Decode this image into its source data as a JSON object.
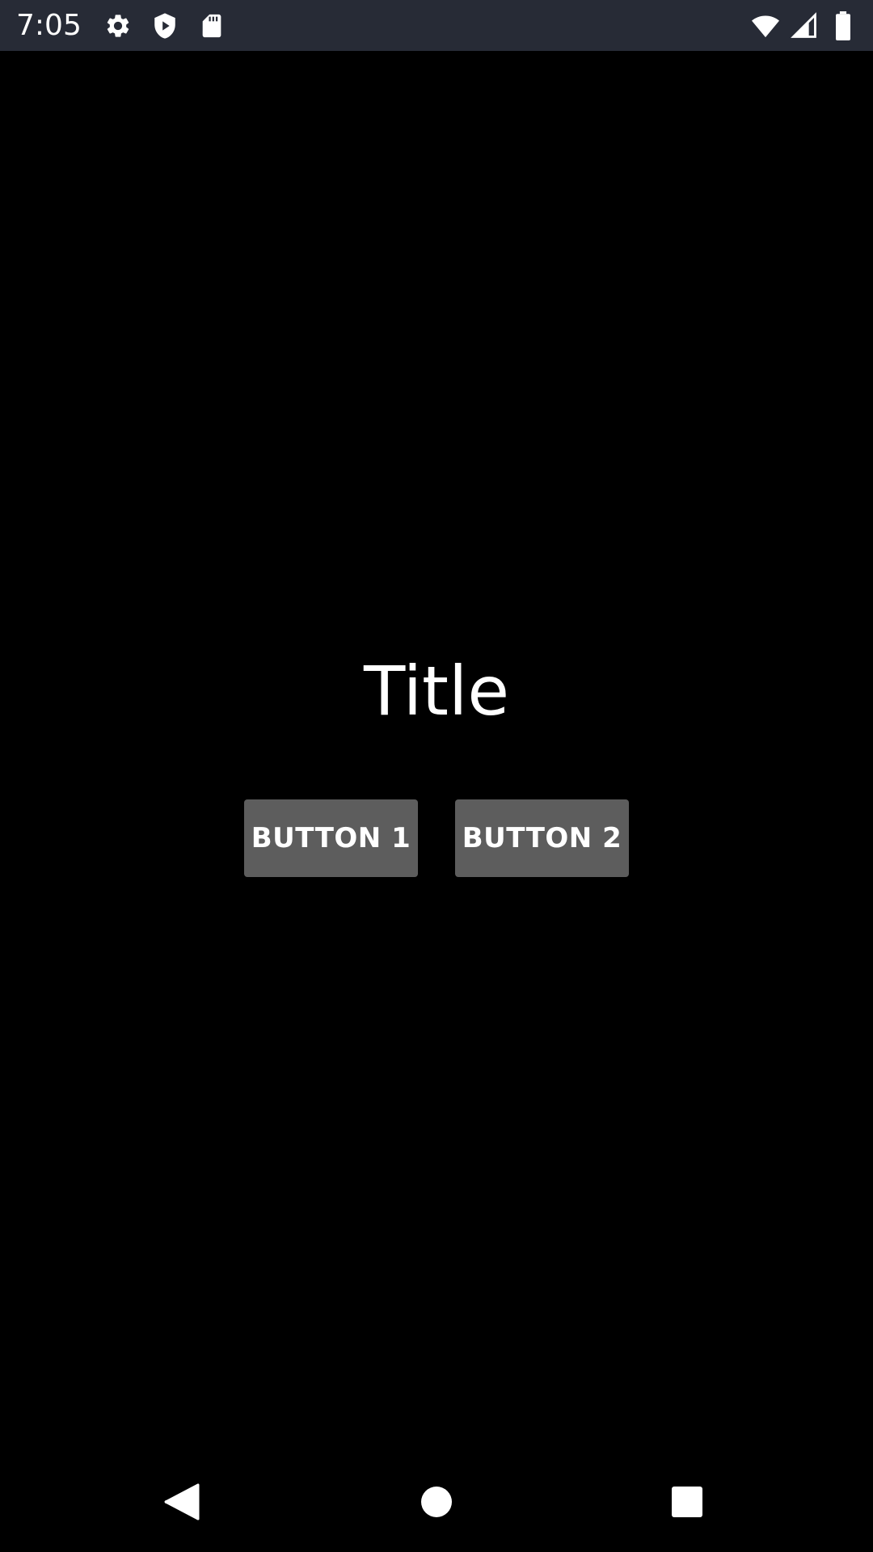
{
  "status_bar": {
    "time": "7:05",
    "left_icons": [
      "gear-icon",
      "shield-play-icon",
      "sd-card-icon"
    ],
    "right_icons": [
      "wifi-icon",
      "cell-signal-icon",
      "battery-icon"
    ],
    "background": "#272b36"
  },
  "main": {
    "title": "Title",
    "buttons": [
      {
        "label": "BUTTON 1"
      },
      {
        "label": "BUTTON 2"
      }
    ],
    "button_color": "#5d5d5d",
    "background": "#000000"
  },
  "nav_bar": {
    "icons": [
      "back-icon",
      "home-icon",
      "recents-icon"
    ]
  }
}
